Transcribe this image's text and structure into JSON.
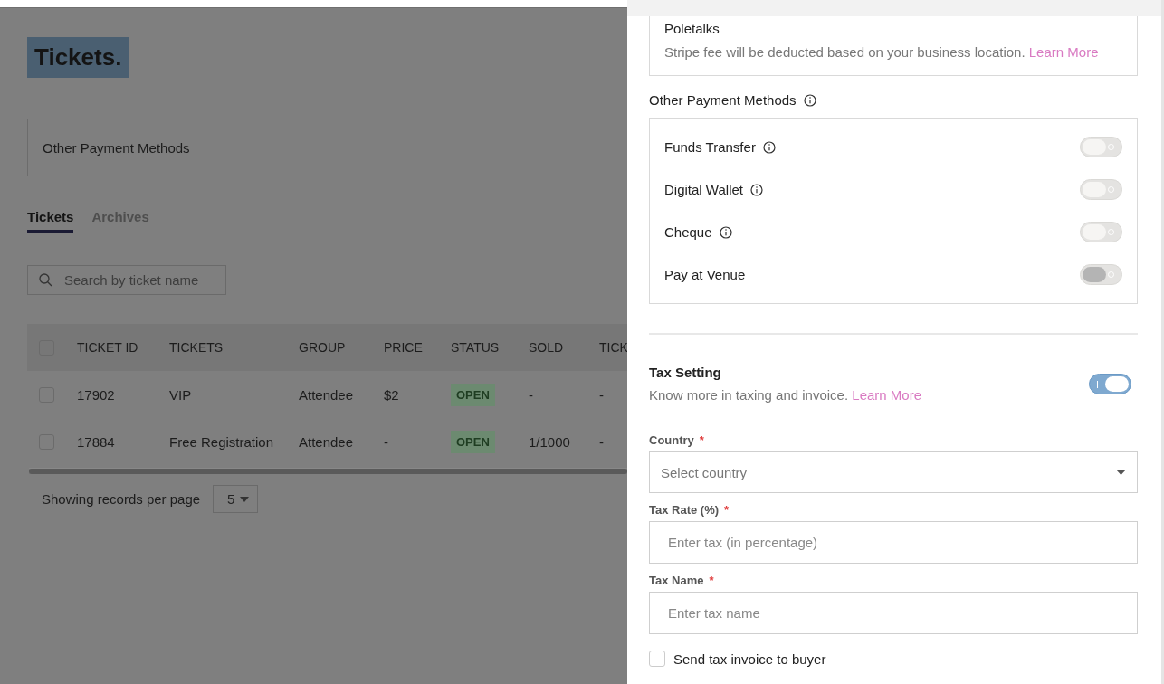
{
  "page": {
    "title": "Tickets.",
    "card_title": "Other Payment Methods",
    "tabs": [
      {
        "label": "Tickets",
        "selected": true
      },
      {
        "label": "Archives",
        "selected": false
      }
    ],
    "search": {
      "placeholder": "Search by ticket name"
    },
    "table": {
      "select_all": false,
      "columns": [
        "TICKET ID",
        "TICKETS",
        "GROUP",
        "PRICE",
        "STATUS",
        "SOLD",
        "TICK"
      ],
      "rows": [
        {
          "selected": false,
          "ticket_id": "17902",
          "ticket": "VIP",
          "group": "Attendee",
          "price": "$2",
          "status": "OPEN",
          "sold": "-",
          "column_7": "-"
        },
        {
          "selected": false,
          "ticket_id": "17884",
          "ticket": "Free Registration",
          "group": "Attendee",
          "price": "-",
          "status": "OPEN",
          "sold": "1/1000",
          "column_7": "-"
        }
      ]
    },
    "footer": {
      "label": "Showing records per page",
      "per_page": "5"
    }
  },
  "panel": {
    "stripe": {
      "name": "Poletalks",
      "note": "Stripe fee will be deducted based on your business location.",
      "link": "Learn More"
    },
    "other_methods": {
      "title": "Other Payment Methods",
      "methods": [
        {
          "label": "Funds Transfer",
          "info": true,
          "on": false,
          "disabled": false
        },
        {
          "label": "Digital Wallet",
          "info": true,
          "on": false,
          "disabled": false
        },
        {
          "label": "Cheque",
          "info": true,
          "on": false,
          "disabled": false
        },
        {
          "label": "Pay at Venue",
          "info": false,
          "on": false,
          "disabled": true
        }
      ]
    },
    "tax": {
      "title": "Tax Setting",
      "note": "Know more in taxing and invoice.",
      "link": "Learn More",
      "on": true,
      "fields": [
        {
          "kind": "select",
          "label": "Country",
          "mark": "*",
          "placeholder": "Select country"
        },
        {
          "kind": "input",
          "label": "Tax Rate (%)",
          "mark": "*",
          "placeholder": "Enter tax (in percentage)"
        },
        {
          "kind": "input",
          "label": "Tax Name",
          "mark": "*",
          "placeholder": "Enter tax name"
        }
      ],
      "send_invoice": {
        "label": "Send tax invoice to buyer",
        "checked": false
      }
    }
  }
}
